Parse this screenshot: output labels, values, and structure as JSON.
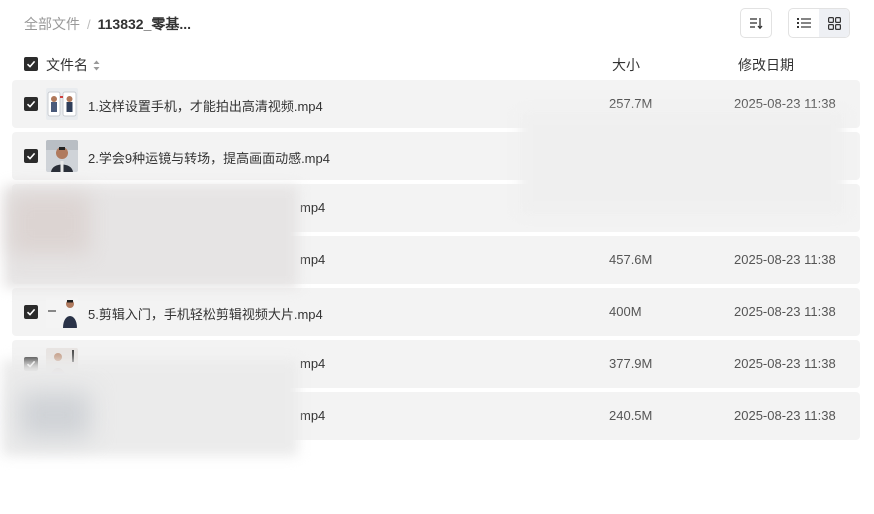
{
  "breadcrumb": {
    "root": "全部文件",
    "separator": "/",
    "current": "113832_零基..."
  },
  "toolbar": {
    "sort_icon": "sort-icon",
    "list_view_icon": "list-view-icon",
    "grid_view_icon": "grid-view-icon"
  },
  "table": {
    "headers": {
      "name": "文件名",
      "size": "大小",
      "modified": "修改日期"
    },
    "rows": [
      {
        "name": "1.这样设置手机，才能拍出高清视频.mp4",
        "size": "257.7M",
        "date": "2025-08-23 11:38",
        "checked": true
      },
      {
        "name": "2.学会9种运镜与转场，提高画面动感.mp4",
        "size": "",
        "date": "",
        "checked": true
      },
      {
        "name": "mp4",
        "size": "",
        "date": "",
        "checked": true
      },
      {
        "name": "mp4",
        "size": "457.6M",
        "date": "2025-08-23 11:38",
        "checked": true
      },
      {
        "name": "5.剪辑入门，手机轻松剪辑视频大片.mp4",
        "size": "400M",
        "date": "2025-08-23 11:38",
        "checked": true
      },
      {
        "name": "mp4",
        "size": "377.9M",
        "date": "2025-08-23 11:38",
        "checked": true
      },
      {
        "name": "mp4",
        "size": "240.5M",
        "date": "2025-08-23 11:38",
        "checked": true
      }
    ]
  },
  "colors": {
    "row_bg": "#f3f3f3",
    "checkbox": "#2b2b2b",
    "muted_text": "#999999"
  }
}
